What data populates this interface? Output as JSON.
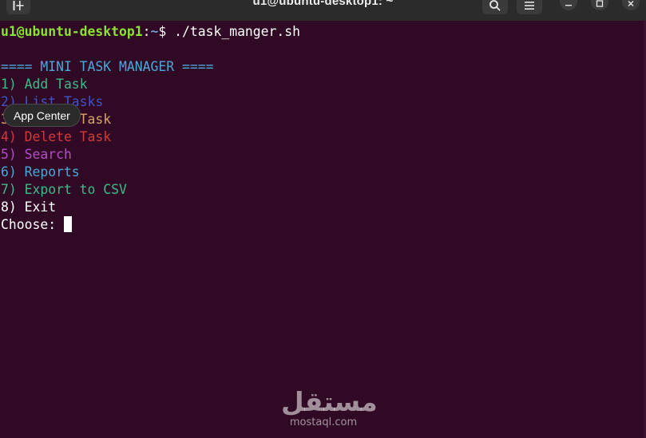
{
  "window": {
    "title": "u1@ubuntu-desktop1: ~",
    "new_tab_icon": "new-tab-icon",
    "search_icon": "search-icon",
    "menu_icon": "hamburger-menu-icon",
    "minimize_icon": "minimize-icon",
    "maximize_icon": "maximize-icon",
    "close_icon": "close-icon"
  },
  "terminal": {
    "prompt": {
      "user_host": "u1@ubuntu-desktop1",
      "separator": ":",
      "path": "~",
      "symbol": "$ ",
      "command": "./task_manger.sh"
    },
    "menu": {
      "header": "==== MINI TASK MANAGER ====",
      "items": [
        {
          "label": "1) Add Task",
          "color": "#3fb98a"
        },
        {
          "label": "2) List Tasks",
          "color": "#3d56c4"
        },
        {
          "label": "3) Update Task",
          "color": "#d7a36b"
        },
        {
          "label": "4) Delete Task",
          "color": "#d23a3a"
        },
        {
          "label": "5) Search",
          "color": "#b04fc7"
        },
        {
          "label": "6) Reports",
          "color": "#4aa7d8"
        },
        {
          "label": "7) Export to CSV",
          "color": "#3fb98a"
        },
        {
          "label": "8) Exit",
          "color": "#ffffff"
        }
      ],
      "header_color": "#4aa7d8"
    },
    "input_prompt": "Choose: "
  },
  "tooltip": {
    "text": "App Center"
  },
  "watermark": {
    "arabic": "مستقل",
    "latin": "mostaql.com"
  },
  "colors": {
    "terminal_bg": "#300a24",
    "titlebar_bg": "#2b2b2b",
    "prompt_user": "#8ae234",
    "prompt_path": "#729fcf"
  }
}
